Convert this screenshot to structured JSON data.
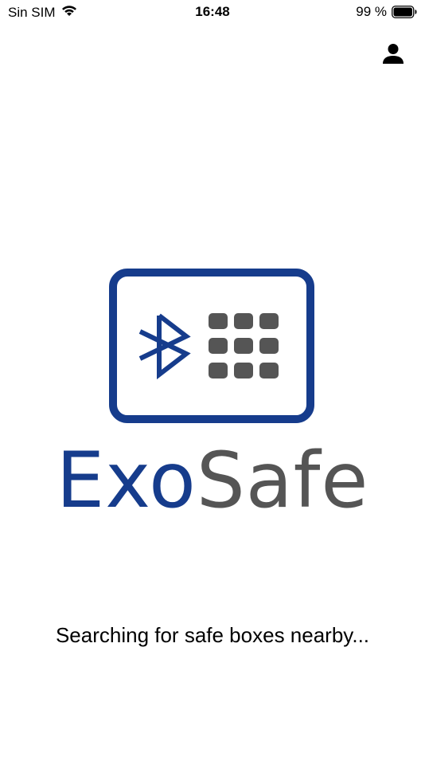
{
  "status_bar": {
    "carrier": "Sin SIM",
    "time": "16:48",
    "battery_percent": "99 %",
    "battery_level": 0.99,
    "icons": [
      "wifi-icon",
      "battery-icon"
    ]
  },
  "header": {
    "profile_icon": "person-icon"
  },
  "logo": {
    "icons": [
      "safe-frame-icon",
      "bluetooth-icon",
      "keypad-icon"
    ],
    "brand_part_1": "Exo",
    "brand_part_2": "Safe",
    "colors": {
      "primary": "#163c8c",
      "secondary": "#555555"
    }
  },
  "main": {
    "status_message": "Searching for safe boxes nearby..."
  }
}
